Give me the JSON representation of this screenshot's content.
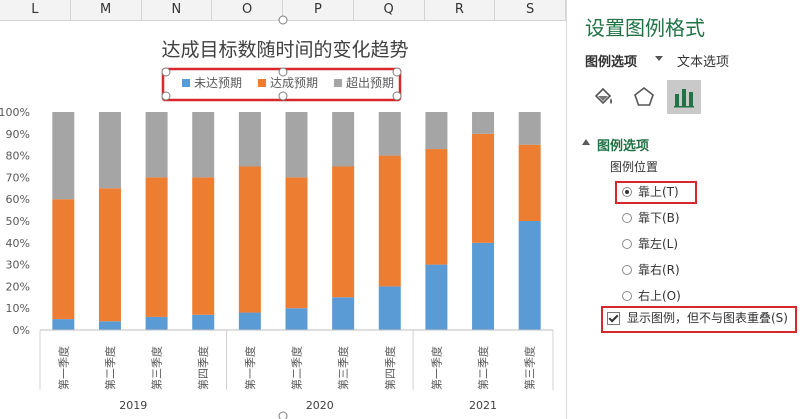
{
  "sheet": {
    "columns": [
      "L",
      "M",
      "N",
      "O",
      "P",
      "Q",
      "R",
      "S"
    ]
  },
  "chart_data": {
    "type": "bar",
    "stacked": true,
    "percent": true,
    "title": "达成目标数随时间的变化趋势",
    "categories": [
      "第一季度",
      "第二季度",
      "第三季度",
      "第四季度",
      "第一季度",
      "第二季度",
      "第三季度",
      "第四季度",
      "第一季度",
      "第二季度",
      "第三季度"
    ],
    "groups": [
      {
        "label": "2019",
        "count": 4
      },
      {
        "label": "2020",
        "count": 4
      },
      {
        "label": "2021",
        "count": 3
      }
    ],
    "series": [
      {
        "name": "未达预期",
        "color": "#5b9bd5",
        "values": [
          5,
          4,
          6,
          7,
          8,
          10,
          15,
          20,
          30,
          40,
          50
        ]
      },
      {
        "name": "达成预期",
        "color": "#ed7d31",
        "values": [
          55,
          61,
          64,
          63,
          67,
          60,
          60,
          60,
          53,
          50,
          35
        ]
      },
      {
        "name": "超出预期",
        "color": "#a5a5a5",
        "values": [
          40,
          35,
          30,
          30,
          25,
          30,
          25,
          20,
          17,
          10,
          15
        ]
      }
    ],
    "yticks": [
      "0%",
      "10%",
      "20%",
      "30%",
      "40%",
      "50%",
      "60%",
      "70%",
      "80%",
      "90%",
      "100%"
    ],
    "ylim": [
      0,
      100
    ],
    "legend_position": "top",
    "grid": false
  },
  "panel": {
    "title": "设置图例格式",
    "tab_legend_options": "图例选项",
    "tab_text_options": "文本选项",
    "section_title": "图例选项",
    "position_label": "图例位置",
    "positions": [
      {
        "label": "靠上(T)",
        "selected": true
      },
      {
        "label": "靠下(B)",
        "selected": false
      },
      {
        "label": "靠左(L)",
        "selected": false
      },
      {
        "label": "靠右(R)",
        "selected": false
      },
      {
        "label": "右上(O)",
        "selected": false
      }
    ],
    "overlap_checkbox_label": "显示图例，但不与图表重叠(S)",
    "overlap_checked": true,
    "accent_color": "#217346",
    "highlight_color": "#d9272e",
    "icons": [
      "fill-line-icon",
      "effects-icon",
      "series-options-icon"
    ]
  }
}
